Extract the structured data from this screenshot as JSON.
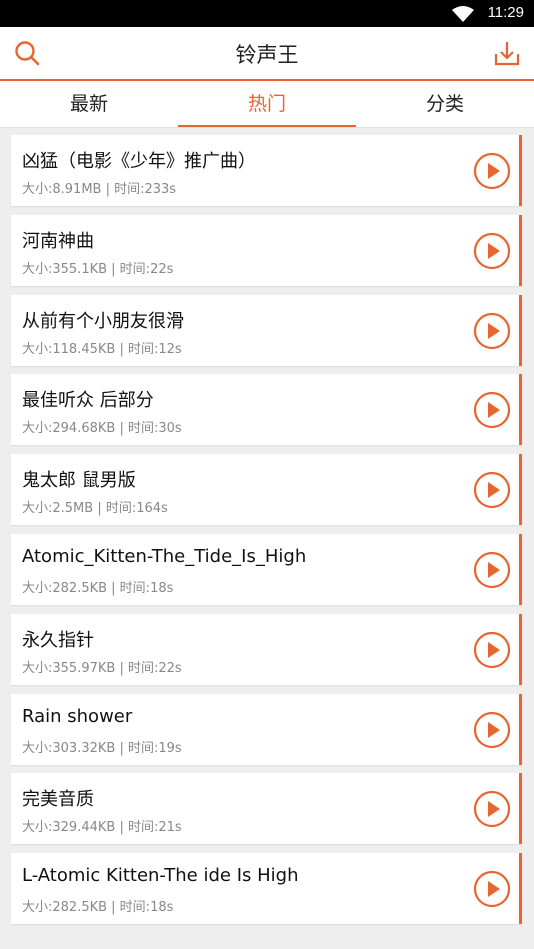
{
  "status_bar": {
    "time": "11:29"
  },
  "header": {
    "title": "铃声王"
  },
  "tabs": [
    {
      "label": "最新"
    },
    {
      "label": "热门"
    },
    {
      "label": "分类"
    }
  ],
  "active_tab": "热门",
  "accent_color": "#e8652f",
  "meta_labels": {
    "size": "大小:",
    "time": "时间:",
    "separator": "|"
  },
  "songs": [
    {
      "name": "凶猛（电影《少年》推广曲）",
      "size": "8.91MB",
      "duration": "233s"
    },
    {
      "name": "河南神曲",
      "size": "355.1KB",
      "duration": "22s"
    },
    {
      "name": "从前有个小朋友很滑",
      "size": "118.45KB",
      "duration": "12s"
    },
    {
      "name": "最佳听众 后部分",
      "size": "294.68KB",
      "duration": "30s"
    },
    {
      "name": "鬼太郎 鼠男版",
      "size": "2.5MB",
      "duration": "164s"
    },
    {
      "name": "Atomic_Kitten-The_Tide_Is_High",
      "size": "282.5KB",
      "duration": "18s"
    },
    {
      "name": "永久指针",
      "size": "355.97KB",
      "duration": "22s"
    },
    {
      "name": "Rain shower",
      "size": "303.32KB",
      "duration": "19s"
    },
    {
      "name": "完美音质",
      "size": "329.44KB",
      "duration": "21s"
    },
    {
      "name": "L-Atomic Kitten-The ide Is High",
      "size": "282.5KB",
      "duration": "18s"
    }
  ]
}
